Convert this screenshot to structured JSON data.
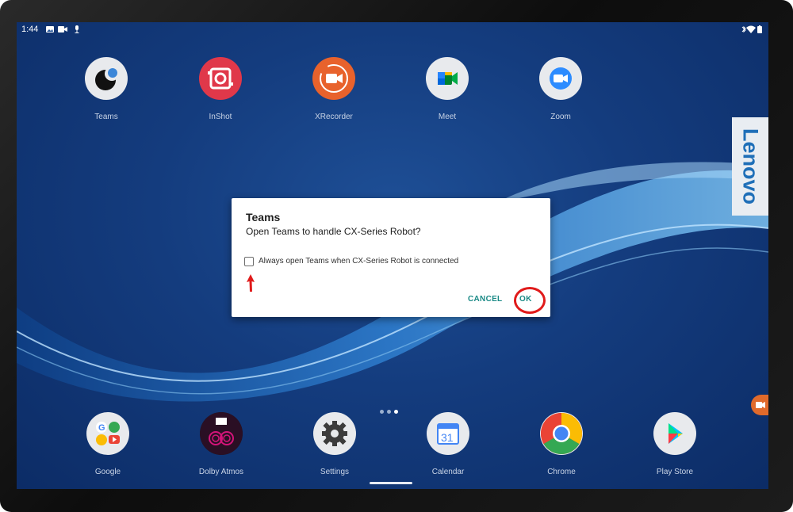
{
  "statusbar": {
    "time": "1:44"
  },
  "apps_top": [
    {
      "label": "Teams",
      "icon": "teams-icon",
      "color": "#e8eaed"
    },
    {
      "label": "InShot",
      "icon": "inshot-icon",
      "color": "#e0384a"
    },
    {
      "label": "XRecorder",
      "icon": "xrecorder-icon",
      "color": "#e8622c"
    },
    {
      "label": "Meet",
      "icon": "meet-icon",
      "color": "#e8eaed"
    },
    {
      "label": "Zoom",
      "icon": "zoom-icon",
      "color": "#e8eaed"
    }
  ],
  "apps_bottom": [
    {
      "label": "Google",
      "icon": "google-folder-icon",
      "color": "#e8eaed"
    },
    {
      "label": "Dolby Atmos",
      "icon": "dolby-atmos-icon",
      "color": "#1a1a1a"
    },
    {
      "label": "Settings",
      "icon": "gear-icon",
      "color": "#e8eaed"
    },
    {
      "label": "Calendar",
      "icon": "calendar-icon",
      "color": "#e8eaed",
      "day": "31"
    },
    {
      "label": "Chrome",
      "icon": "chrome-icon",
      "color": "#e8eaed"
    },
    {
      "label": "Play Store",
      "icon": "play-store-icon",
      "color": "#e8eaed"
    }
  ],
  "brand": {
    "text": "Lenovo",
    "color": "#1f6fb8"
  },
  "dialog": {
    "title": "Teams",
    "message": "Open Teams to handle CX-Series Robot?",
    "checkbox_label": "Always open Teams when CX-Series Robot is connected",
    "checkbox_checked": false,
    "cancel_label": "CANCEL",
    "ok_label": "OK",
    "accent": "#1a8a86"
  },
  "annotation_color": "#e01b1b"
}
